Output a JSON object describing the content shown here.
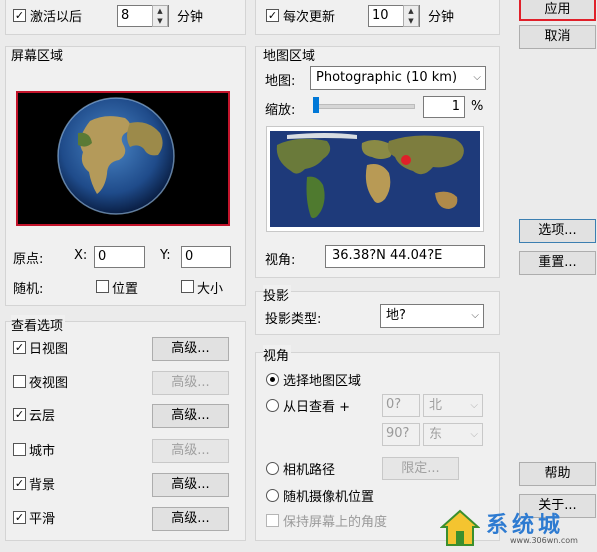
{
  "top": {
    "activate_after_label": "激活以后",
    "activate_after_value": "8",
    "minutes_label_1": "分钟",
    "update_each_label": "每次更新",
    "update_each_value": "10",
    "minutes_label_2": "分钟",
    "check_mark": "✓"
  },
  "screen_area": {
    "title": "屏幕区域",
    "origin_label": "原点:",
    "x_label": "X:",
    "x_value": "0",
    "y_label": "Y:",
    "y_value": "0",
    "random_label": "随机:",
    "position_label": "位置",
    "size_label": "大小"
  },
  "map_area": {
    "title": "地图区域",
    "map_label": "地图:",
    "map_value": "Photographic (10 km)",
    "zoom_label": "缩放:",
    "zoom_value": "1",
    "zoom_unit": "%",
    "zoom_level": 0.01,
    "view_label": "视角:",
    "view_value": "36.38?N    44.04?E"
  },
  "view_options": {
    "title": "查看选项",
    "items": [
      {
        "label": "日视图",
        "checked": true,
        "button": "高级...",
        "enabled": true
      },
      {
        "label": "夜视图",
        "checked": false,
        "button": "高级...",
        "enabled": false
      },
      {
        "label": "云层",
        "checked": true,
        "button": "高级...",
        "enabled": true
      },
      {
        "label": "城市",
        "checked": false,
        "button": "高级...",
        "enabled": false
      },
      {
        "label": "背景",
        "checked": true,
        "button": "高级...",
        "enabled": true
      },
      {
        "label": "平滑",
        "checked": true,
        "button": "高级...",
        "enabled": true
      }
    ]
  },
  "projection": {
    "title": "投影",
    "type_label": "投影类型:",
    "type_value": "地?"
  },
  "viewpoint": {
    "title": "视角",
    "select_map_area": "选择地图区域",
    "from_sun": "从日查看 +",
    "from_sun_val1": "0?",
    "from_sun_dir1": "北",
    "from_sun_val2": "90?",
    "from_sun_dir2": "东",
    "camera_path": "相机路径",
    "limit_button": "限定...",
    "random_camera": "随机摄像机位置",
    "keep_angle": "保持屏幕上的角度"
  },
  "right_buttons": {
    "apply": "应用",
    "cancel": "取消",
    "options": "选项...",
    "reset": "重置...",
    "help": "帮助",
    "close": "关于..."
  },
  "watermark": {
    "text": "系统城",
    "url": "www.306wn.com"
  },
  "colors": {
    "apply_highlight": "#e0202a",
    "focus_border": "#3c7fb1"
  }
}
